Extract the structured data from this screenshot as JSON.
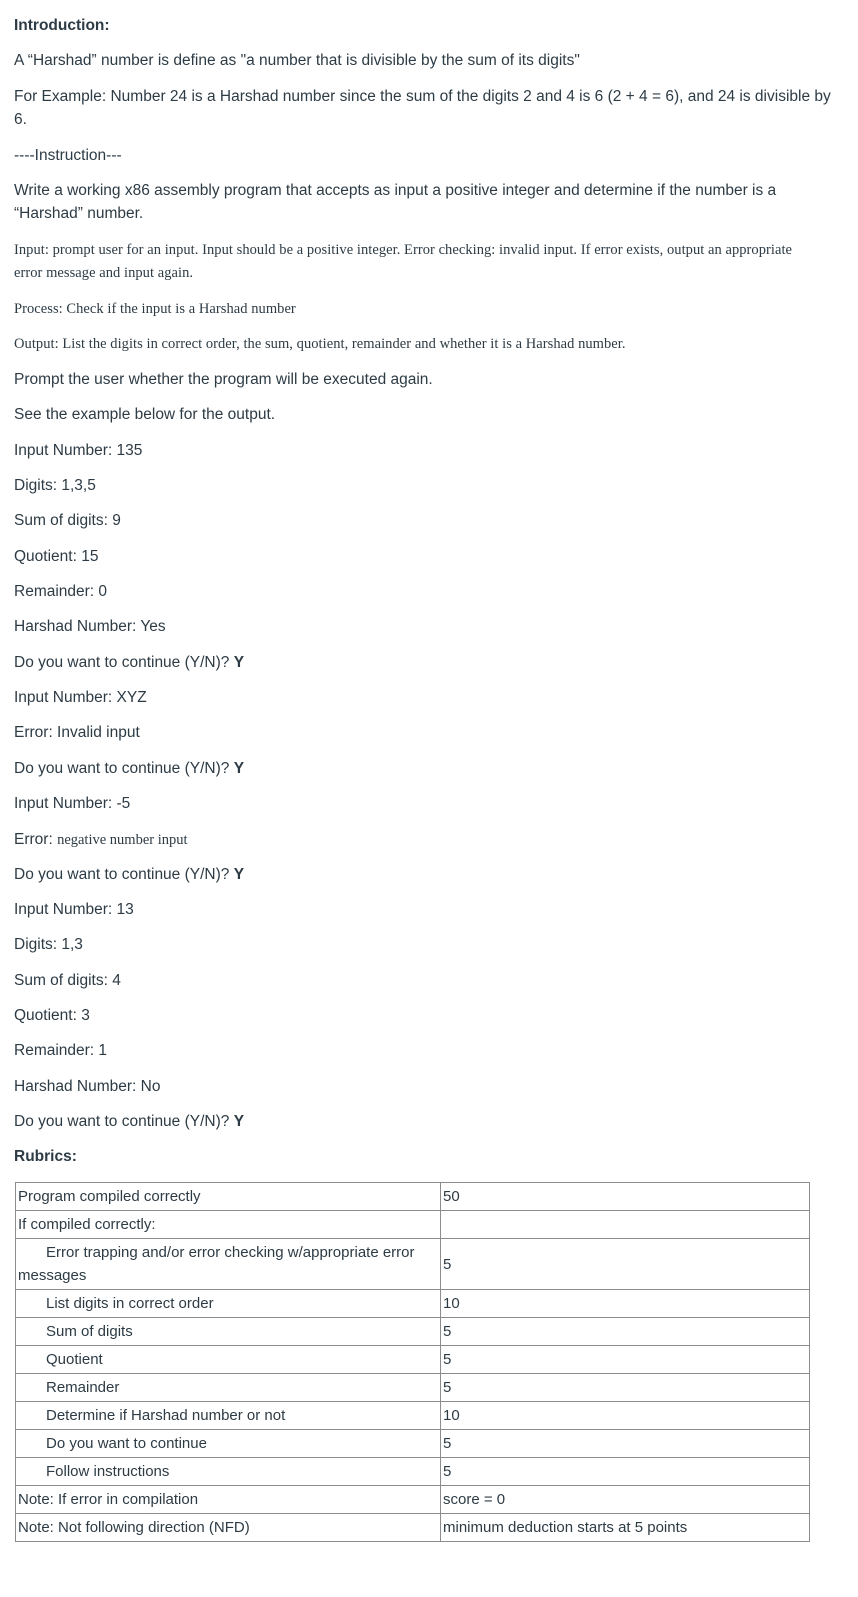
{
  "intro": {
    "heading": "Introduction:",
    "definition": "A “Harshad” number is define as \"a number that is divisible by the sum of its digits\"",
    "example": "For Example: Number 24 is a Harshad number since the sum of the digits 2 and 4 is 6 (2 + 4 = 6), and 24 is divisible by 6."
  },
  "instruction": {
    "heading": "----Instruction---",
    "task": "Write a working x86 assembly program that accepts as input a positive integer and determine if the number is a “Harshad” number.",
    "input": "Input: prompt user for an input.  Input should be a positive integer.  Error checking: invalid input.  If error exists, output an appropriate error message and input again.",
    "process": "Process: Check if the input is a Harshad number",
    "output": "Output: List the digits in correct order, the sum, quotient, remainder and whether it is a Harshad number.",
    "prompt_again": "Prompt the user whether the program will be executed again.",
    "see_example": "See the example below for the output."
  },
  "example_run": {
    "r1_input": "Input Number: 135",
    "r1_digits": "Digits: 1,3,5",
    "r1_sum": "Sum of digits: 9",
    "r1_quotient": "Quotient: 15",
    "r1_remainder": "Remainder: 0",
    "r1_harshad": "Harshad Number: Yes",
    "continue_prompt": "Do you want to continue (Y/N)? ",
    "continue_answer": "Y",
    "r2_input": "Input Number: XYZ",
    "r2_error": "Error: Invalid input",
    "r3_input": "Input Number: -5",
    "r3_error_label": "Error: ",
    "r3_error_text": "negative number input",
    "r4_input": "Input Number: 13",
    "r4_digits": "Digits: 1,3",
    "r4_sum": "Sum of digits: 4",
    "r4_quotient": "Quotient: 3",
    "r4_remainder": "Remainder: 1",
    "r4_harshad": "Harshad Number: No"
  },
  "rubrics": {
    "heading": "Rubrics:",
    "rows": [
      {
        "label": "Program compiled correctly",
        "points": "50"
      },
      {
        "label": "If compiled correctly:",
        "points": ""
      },
      {
        "label": "Error trapping and/or error checking w/appropriate error messages",
        "points": "5"
      },
      {
        "label": "List digits in correct order",
        "points": "10"
      },
      {
        "label": "Sum of digits",
        "points": "5"
      },
      {
        "label": "Quotient",
        "points": "5"
      },
      {
        "label": "Remainder",
        "points": "5"
      },
      {
        "label": "Determine if Harshad number or not",
        "points": "10"
      },
      {
        "label": "Do you want to continue",
        "points": "5"
      },
      {
        "label": "Follow instructions",
        "points": "5"
      },
      {
        "label": "Note: If error in compilation",
        "points": "score = 0"
      },
      {
        "label": "Note: Not following direction (NFD)",
        "points": "minimum deduction starts at 5 points"
      }
    ]
  }
}
